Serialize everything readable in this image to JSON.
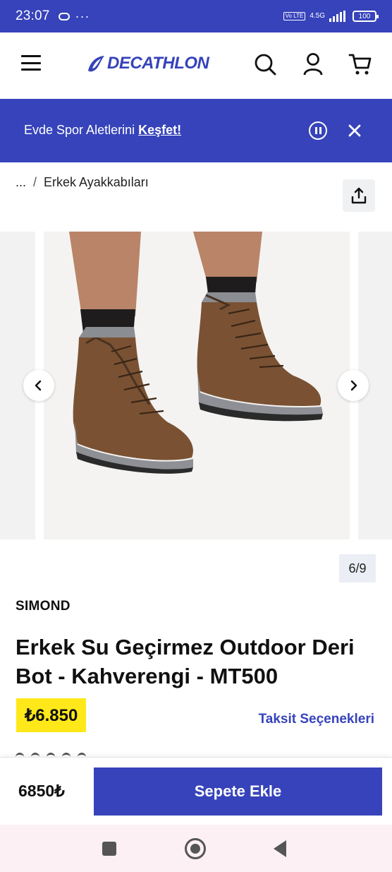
{
  "status_bar": {
    "time": "23:07",
    "dots": "···",
    "volte": "Vo LTE",
    "network": "4.5G",
    "battery": "100",
    "icons": [
      "game-controller-icon",
      "signal-icon",
      "battery-icon"
    ]
  },
  "header": {
    "brand": "DECATHLON",
    "icons": [
      "menu-icon",
      "search-icon",
      "account-icon",
      "cart-icon"
    ],
    "brand_color": "#3643ba"
  },
  "promo": {
    "text": "Evde Spor Aletlerini ",
    "link": "Keşfet!",
    "icons": [
      "pause-icon",
      "close-icon"
    ]
  },
  "breadcrumb": {
    "ellipsis": "...",
    "separator": "/",
    "current": "Erkek Ayakkabıları"
  },
  "gallery": {
    "counter": "6/9",
    "icons": [
      "chevron-left-icon",
      "chevron-right-icon",
      "share-icon"
    ]
  },
  "product": {
    "brand": "SIMOND",
    "title": "Erkek Su Geçirmez Outdoor Deri Bot - Kahverengi - MT500",
    "price": "₺6.850",
    "installments_link": "Taksit Seçenekleri",
    "price_highlight_color": "#ffe81a"
  },
  "cart_bar": {
    "price": "6850₺",
    "add_label": "Sepete Ekle"
  },
  "system_nav": {
    "icons": [
      "recents-icon",
      "home-icon",
      "back-icon"
    ]
  }
}
